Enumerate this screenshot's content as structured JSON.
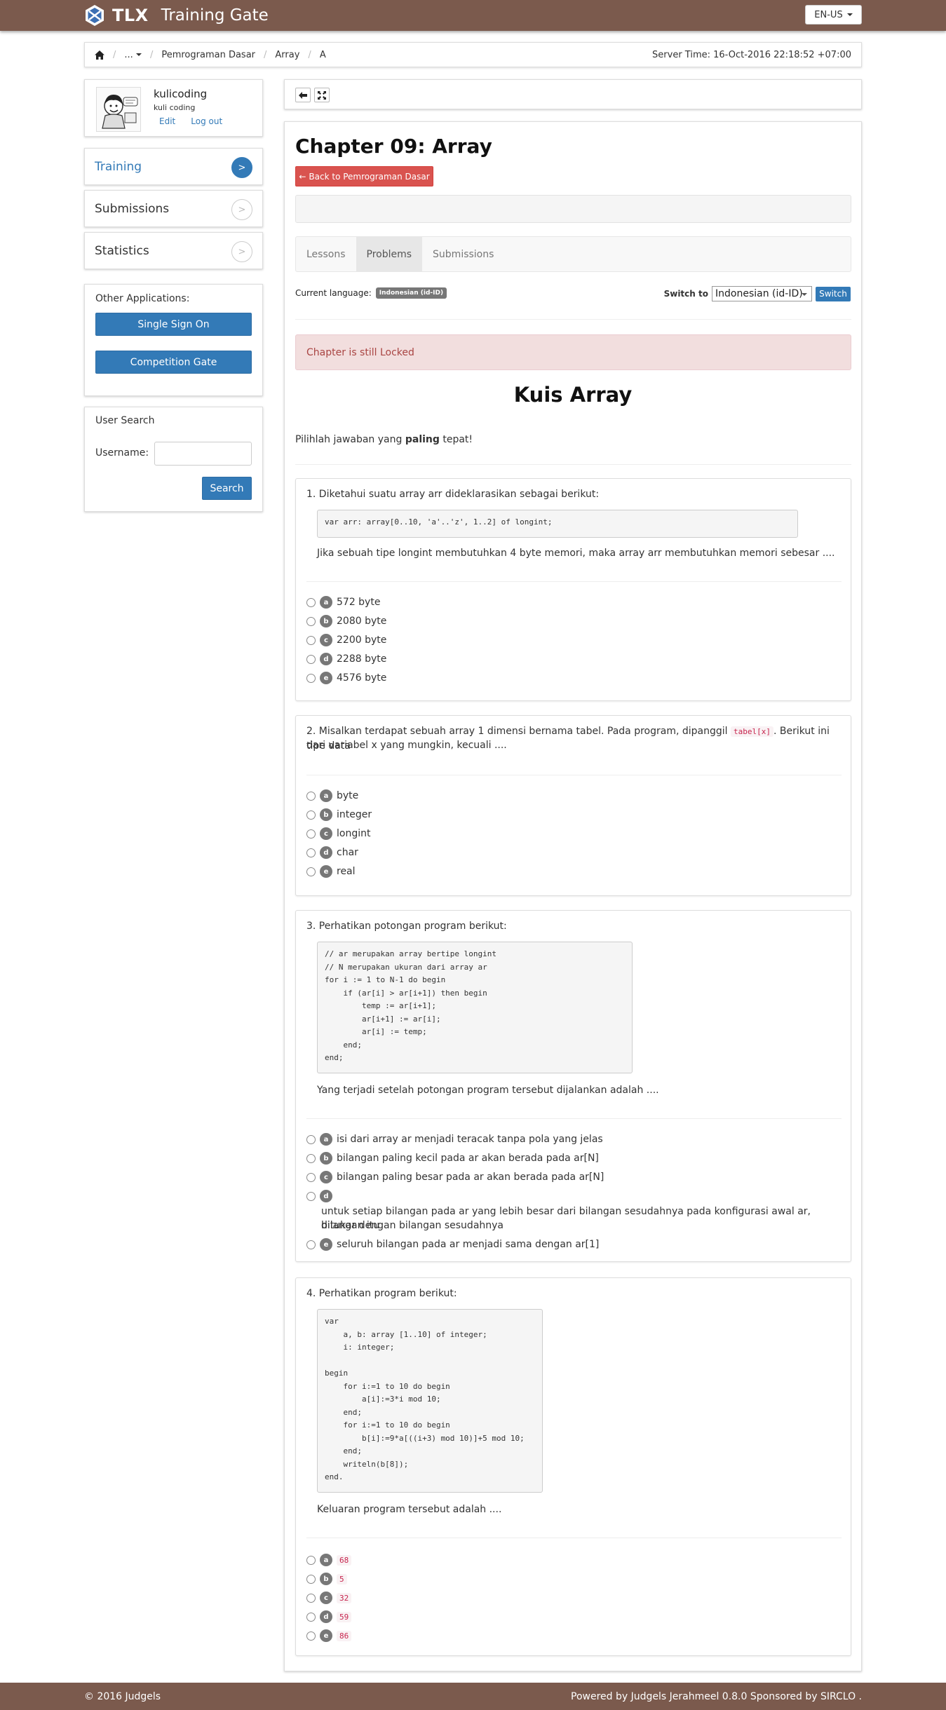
{
  "navbar": {
    "brand_tlx": "TLX",
    "brand_name": "Training Gate",
    "language": "EN-US"
  },
  "breadcrumb": {
    "items": [
      "...",
      "Pemrograman Dasar",
      "Array",
      "A"
    ],
    "server_time": "Server Time: 16-Oct-2016 22:18:52 +07:00"
  },
  "user": {
    "username": "kulicoding",
    "fullname": "kuli coding",
    "edit": "Edit",
    "logout": "Log out"
  },
  "sidebar": {
    "items": [
      {
        "label": "Training",
        "arrow": ">"
      },
      {
        "label": "Submissions",
        "arrow": ">"
      },
      {
        "label": "Statistics",
        "arrow": ">"
      }
    ]
  },
  "apps": {
    "title": "Other Applications:",
    "sso": "Single Sign On",
    "competition": "Competition Gate"
  },
  "user_search": {
    "title": "User Search",
    "label": "Username:",
    "value": "",
    "button": "Search"
  },
  "chapter": {
    "title": "Chapter 09: Array",
    "back": "Back to Pemrograman Dasar",
    "tabs": [
      "Lessons",
      "Problems",
      "Submissions"
    ],
    "current_language_label": "Current language:",
    "current_language": "Indonesian (id-ID)",
    "switch_to_label": "Switch to",
    "switch_value": "Indonesian (id-ID)",
    "switch_button": "Switch",
    "locked": "Chapter is still Locked"
  },
  "quiz": {
    "title": "Kuis Array",
    "instruction_pre": "Pilihlah jawaban yang ",
    "instruction_bold": "paling",
    "instruction_post": " tepat!",
    "q1": {
      "text": "1. Diketahui suatu array arr dideklarasikan sebagai berikut:",
      "code": "var arr: array[0..10, 'a'..'z', 1..2] of longint;",
      "text2": "Jika sebuah tipe longint membutuhkan 4 byte memori, maka array arr membutuhkan memori sebesar ....",
      "options": [
        {
          "letter": "a",
          "text": "572 byte"
        },
        {
          "letter": "b",
          "text": "2080 byte"
        },
        {
          "letter": "c",
          "text": "2200 byte"
        },
        {
          "letter": "d",
          "text": "2288 byte"
        },
        {
          "letter": "e",
          "text": "4576 byte"
        }
      ]
    },
    "q2": {
      "text_pre": "2. Misalkan terdapat sebuah array 1 dimensi bernama tabel. Pada program, dipanggil ",
      "code": "tabel[x]",
      "text_post": ". Berikut ini tipe data",
      "text_line2": "dari variabel x yang mungkin, kecuali ....",
      "options": [
        {
          "letter": "a",
          "text": "byte"
        },
        {
          "letter": "b",
          "text": "integer"
        },
        {
          "letter": "c",
          "text": "longint"
        },
        {
          "letter": "d",
          "text": "char"
        },
        {
          "letter": "e",
          "text": "real"
        }
      ]
    },
    "q3": {
      "text": "3. Perhatikan potongan program berikut:",
      "code": "// ar merupakan array bertipe longint\n// N merupakan ukuran dari array ar\nfor i := 1 to N-1 do begin\n    if (ar[i] > ar[i+1]) then begin\n        temp := ar[i+1];\n        ar[i+1] := ar[i];\n        ar[i] := temp;\n    end;\nend;",
      "text2": "Yang terjadi setelah potongan program tersebut dijalankan adalah ....",
      "options": [
        {
          "letter": "a",
          "text": "isi dari array ar menjadi teracak tanpa pola yang jelas"
        },
        {
          "letter": "b",
          "text": "bilangan paling kecil pada ar akan berada pada ar[N]"
        },
        {
          "letter": "c",
          "text": "bilangan paling besar pada ar akan berada pada ar[N]"
        },
        {
          "letter": "d",
          "text": ""
        },
        {
          "letter": "e",
          "text": "seluruh bilangan pada ar menjadi sama dengan ar[1]"
        }
      ],
      "option_d_line1": "untuk setiap bilangan pada ar yang lebih besar dari bilangan sesudahnya pada konfigurasi awal ar, bilangan itu",
      "option_d_line2": "ditukar dengan bilangan sesudahnya"
    },
    "q4": {
      "text": "4. Perhatikan program berikut:",
      "code": "var\n    a, b: array [1..10] of integer;\n    i: integer;\n\nbegin\n    for i:=1 to 10 do begin\n        a[i]:=3*i mod 10;\n    end;\n    for i:=1 to 10 do begin\n        b[i]:=9*a[((i+3) mod 10)]+5 mod 10;\n    end;\n    writeln(b[8]);\nend.",
      "text2": "Keluaran program tersebut adalah ....",
      "options": [
        {
          "letter": "a",
          "text": "68"
        },
        {
          "letter": "b",
          "text": "5"
        },
        {
          "letter": "c",
          "text": "32"
        },
        {
          "letter": "d",
          "text": "59"
        },
        {
          "letter": "e",
          "text": "86"
        }
      ]
    }
  },
  "footer": {
    "left": "© 2016 Judgels",
    "right": "Powered by Judgels Jerahmeel 0.8.0 Sponsored by SIRCLO ."
  }
}
